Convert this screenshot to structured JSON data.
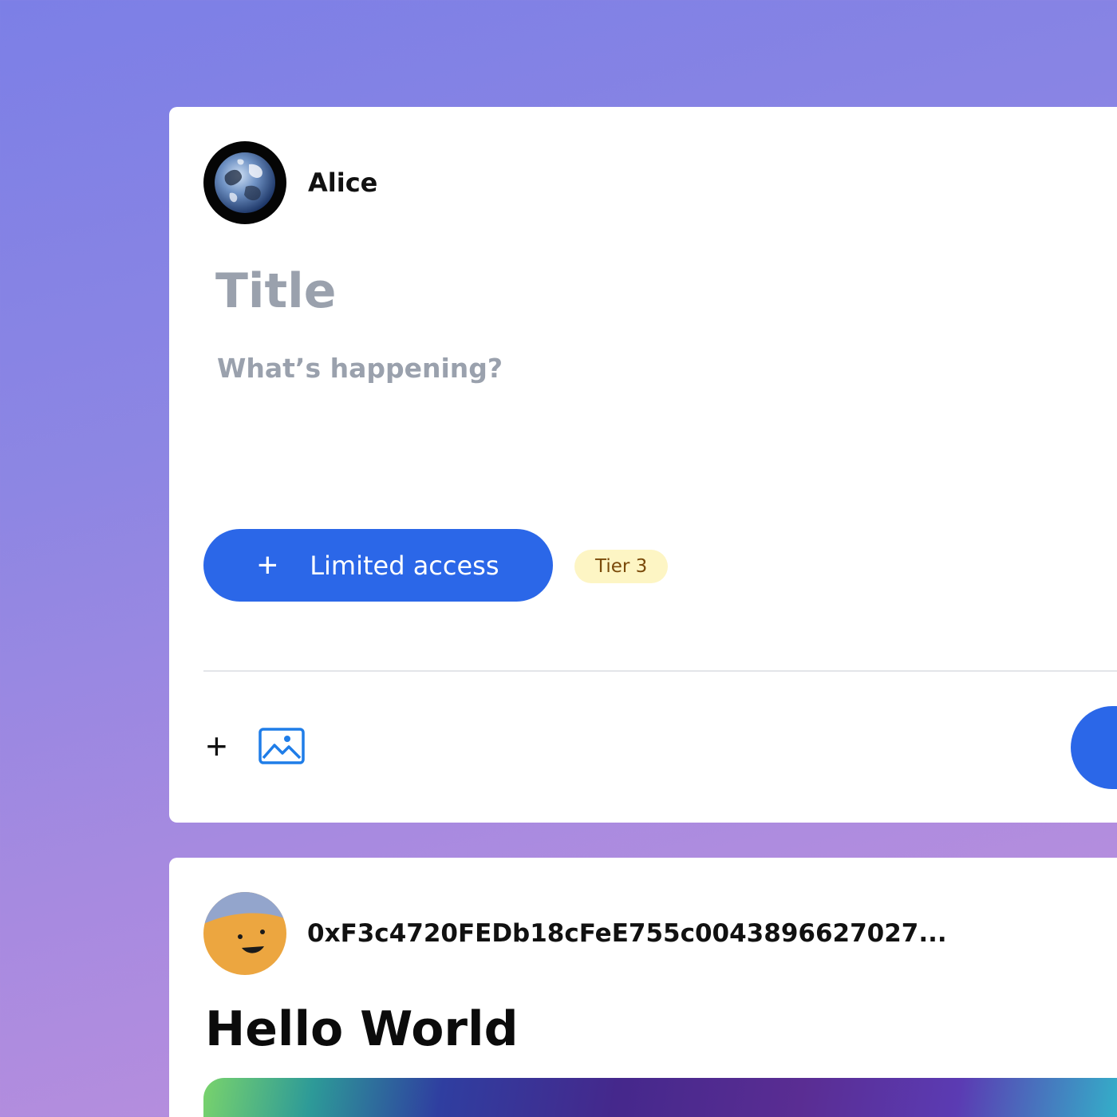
{
  "composer": {
    "author": {
      "name": "Alice",
      "avatar_icon": "earth-avatar"
    },
    "title_placeholder": "Title",
    "body_placeholder": "What’s happening?",
    "access_button": {
      "icon": "plus-icon",
      "label": "Limited access"
    },
    "tier_badge": "Tier 3",
    "toolbar": {
      "add_icon": "plus-icon",
      "image_icon": "image-icon"
    },
    "submit_color": "#2b67e8"
  },
  "post": {
    "author": "0xF3c4720FEDb18cFeE755c0043896627027...",
    "avatar_icon": "smiley-avatar",
    "title": "Hello World"
  },
  "colors": {
    "accent": "#2b67e8",
    "badge_bg": "#fdf5c4",
    "badge_text": "#7a4a0a",
    "placeholder": "#9aa1ad"
  }
}
